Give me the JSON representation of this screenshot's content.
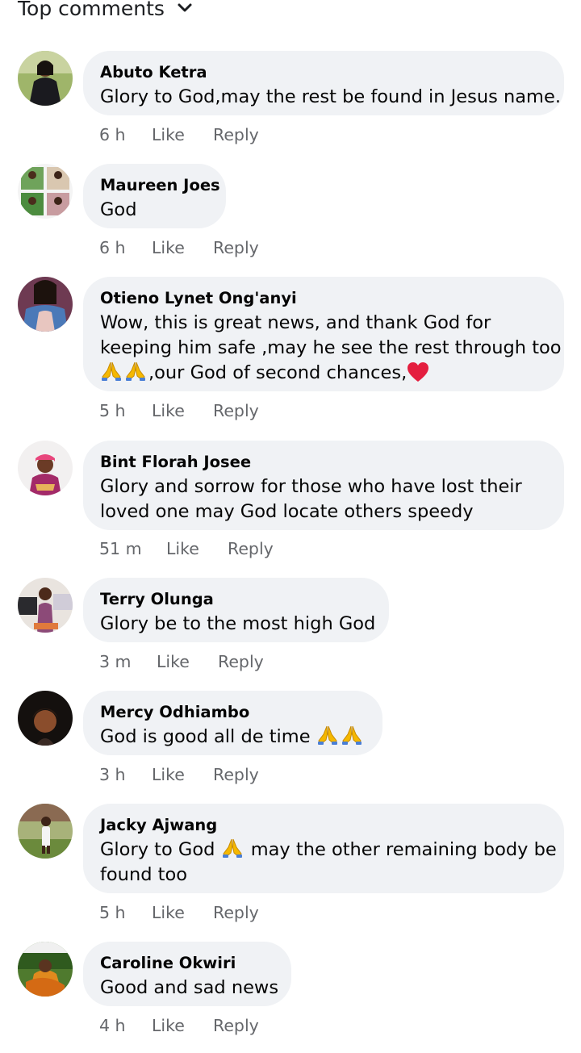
{
  "header": {
    "sort_label": "Top comments",
    "sort_icon": "chevron-down-icon"
  },
  "colors": {
    "bubble": "#f0f2f5",
    "meta_text": "#65676b",
    "text": "#050505",
    "pray_emoji": "#f5b800",
    "heart_emoji": "#e41e3f"
  },
  "comments": [
    {
      "author": "Abuto Ketra",
      "lines": [
        "Glory to God,may the rest be found in Jesus name."
      ],
      "time": "6 h",
      "like": "Like",
      "reply": "Reply"
    },
    {
      "author": "Maureen Joes",
      "lines": [
        "God"
      ],
      "time": "6 h",
      "like": "Like",
      "reply": "Reply"
    },
    {
      "author": "Otieno Lynet Ong'anyi",
      "lines": [
        "Wow, this is great news, and thank God for",
        "keeping him safe ,may he see the rest through too"
      ],
      "line3_text": ",our God of second chances,",
      "time": "5 h",
      "like": "Like",
      "reply": "Reply"
    },
    {
      "author": "Bint Florah Josee",
      "lines": [
        "Glory and sorrow for those who have lost their",
        "loved one may God locate others speedy"
      ],
      "time": "51 m",
      "like": "Like",
      "reply": "Reply"
    },
    {
      "author": "Terry Olunga",
      "lines": [
        "Glory be to the most high God"
      ],
      "time": "3 m",
      "like": "Like",
      "reply": "Reply"
    },
    {
      "author": "Mercy Odhiambo",
      "lines": [
        "God is good all de time "
      ],
      "time": "3 h",
      "like": "Like",
      "reply": "Reply"
    },
    {
      "author": "Jacky Ajwang",
      "line1_before": "Glory to God ",
      "line1_after": " may the other remaining body be",
      "lines": [
        "found too"
      ],
      "time": "5 h",
      "like": "Like",
      "reply": "Reply"
    },
    {
      "author": "Caroline Okwiri",
      "lines": [
        "Good and sad news"
      ],
      "time": "4 h",
      "like": "Like",
      "reply": "Reply"
    }
  ]
}
